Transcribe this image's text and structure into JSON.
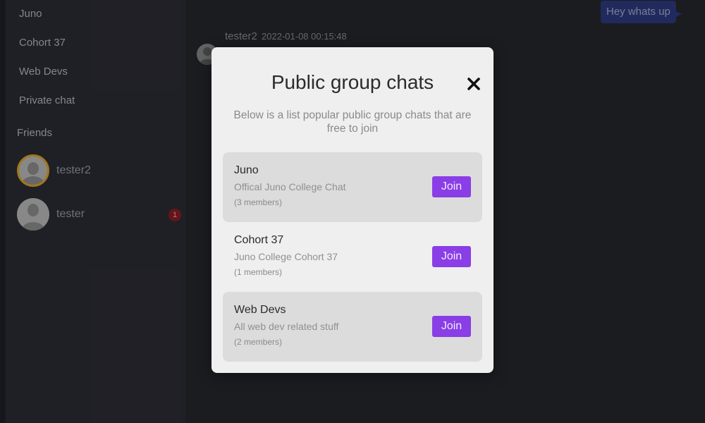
{
  "sidebar": {
    "channels": [
      "Juno",
      "Cohort 37",
      "Web Devs",
      "Private chat"
    ],
    "friends_label": "Friends",
    "friends": [
      {
        "name": "tester2",
        "online": true,
        "unread": ""
      },
      {
        "name": "tester",
        "online": false,
        "unread": "1"
      }
    ]
  },
  "chat": {
    "own_message": "Hey whats up",
    "author": "tester2",
    "timestamp": "2022-01-08 00:15:48"
  },
  "modal": {
    "title": "Public group chats",
    "description": "Below is a list popular public group chats that are free to join",
    "join_label": "Join",
    "groups": [
      {
        "name": "Juno",
        "description": "Offical Juno College Chat",
        "members": "(3 members)"
      },
      {
        "name": "Cohort 37",
        "description": "Juno College Cohort 37",
        "members": "(1 members)"
      },
      {
        "name": "Web Devs",
        "description": "All web dev related stuff",
        "members": "(2 members)"
      }
    ]
  },
  "colors": {
    "accent": "#8a3ee6",
    "bubble": "#2f3b80",
    "online_ring": "#e0a42a",
    "badge": "#8e1d22"
  }
}
